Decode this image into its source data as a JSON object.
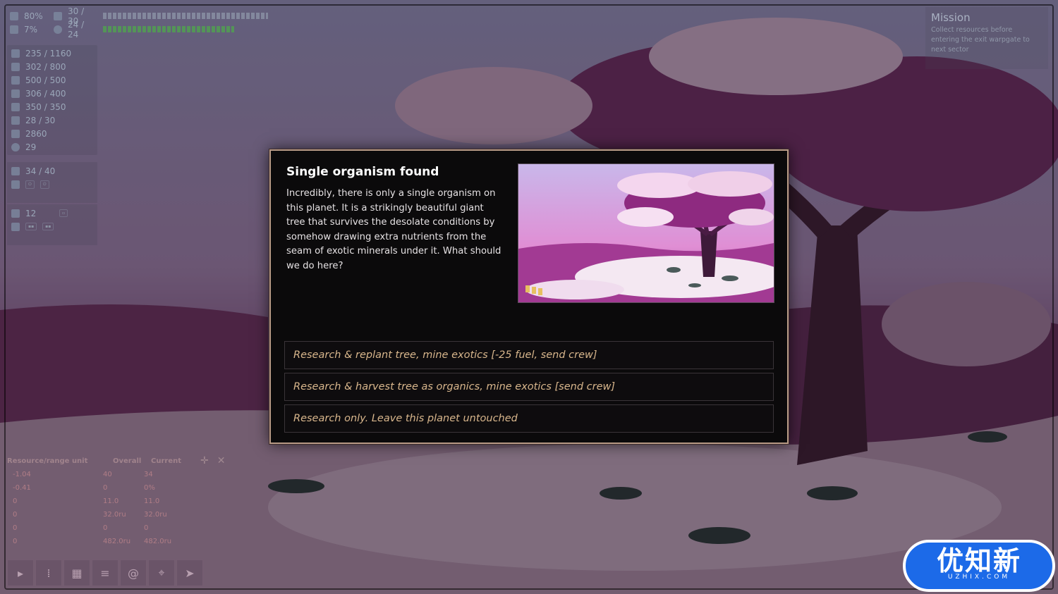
{
  "top_stats": {
    "hull_pct": "80%",
    "hull_slots": "30 / 30",
    "crew_pct": "7%",
    "crew_slots": "24 / 24"
  },
  "resources": [
    {
      "icon": "fuel-icon",
      "value": "235 / 1160"
    },
    {
      "icon": "organics-icon",
      "value": "302 / 800"
    },
    {
      "icon": "metals-icon",
      "value": "500 / 500"
    },
    {
      "icon": "minerals-icon",
      "value": "306 / 400"
    },
    {
      "icon": "exotics-icon",
      "value": "350 / 350"
    },
    {
      "icon": "probes-icon",
      "value": "28 / 30"
    },
    {
      "icon": "credits-icon",
      "value": "2860"
    },
    {
      "icon": "sectors-icon",
      "value": "29"
    }
  ],
  "energy": {
    "value": "34 / 40"
  },
  "crew": {
    "value": "12"
  },
  "mission": {
    "title": "Mission",
    "text": "Collect resources before entering the exit warpgate to next sector"
  },
  "range_panel": {
    "header": "Resource/range unit",
    "overall": "Overall",
    "current": "Current",
    "left_values": [
      "-1.04",
      "-0.41",
      "0",
      "0",
      "0",
      "0"
    ],
    "right_rows": [
      {
        "overall": "40",
        "current": "34"
      },
      {
        "overall": "0",
        "current": "0%"
      },
      {
        "overall": "11.0",
        "current": "11.0"
      },
      {
        "overall": "32.0ru",
        "current": "32.0ru"
      },
      {
        "overall": "0",
        "current": "0"
      },
      {
        "overall": "482.0ru",
        "current": "482.0ru"
      }
    ]
  },
  "dialog": {
    "title": "Single organism found",
    "body": "Incredibly, there is only a single organism on this planet. It is a strikingly beautiful giant tree that survives the desolate conditions by somehow drawing extra nutrients from the seam of exotic minerals under it.  What should we do here?",
    "options": [
      "Research & replant tree, mine exotics [-25 fuel, send crew]",
      "Research & harvest tree as organics, mine exotics [send crew]",
      "Research only. Leave this planet untouched"
    ]
  },
  "watermark": {
    "big": "优知新",
    "small": "UZHIX.COM"
  },
  "colors": {
    "option_text": "#d8b68c",
    "dialog_border": "#b89a86",
    "watermark_blue": "#1c6ae8"
  }
}
